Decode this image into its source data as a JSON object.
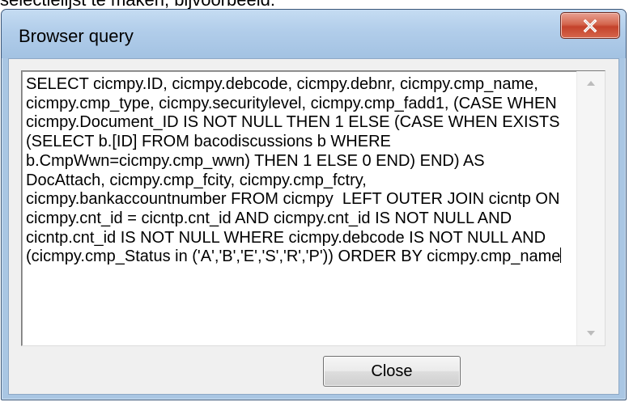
{
  "page": {
    "caption": "selectielijst te maken, bijvoorbeeld:"
  },
  "dialog": {
    "title": "Browser query",
    "close_x_glyph": "X",
    "query_text": "SELECT cicmpy.ID, cicmpy.debcode, cicmpy.debnr, cicmpy.cmp_name, cicmpy.cmp_type, cicmpy.securitylevel, cicmpy.cmp_fadd1, (CASE WHEN cicmpy.Document_ID IS NOT NULL THEN 1 ELSE (CASE WHEN EXISTS (SELECT b.[ID] FROM bacodiscussions b WHERE b.CmpWwn=cicmpy.cmp_wwn) THEN 1 ELSE 0 END) END) AS DocAttach, cicmpy.cmp_fcity, cicmpy.cmp_fctry, cicmpy.bankaccountnumber FROM cicmpy  LEFT OUTER JOIN cicntp ON cicmpy.cnt_id = cicntp.cnt_id AND cicmpy.cnt_id IS NOT NULL AND cicntp.cnt_id IS NOT NULL WHERE cicmpy.debcode IS NOT NULL AND (cicmpy.cmp_Status in ('A','B','E','S','R','P')) ORDER BY cicmpy.cmp_name",
    "close_button_label": "Close",
    "icons": {
      "scroll_up": "scroll-up-arrow-icon",
      "scroll_down": "scroll-down-arrow-icon",
      "close": "close-icon"
    }
  },
  "colors": {
    "frame": "#a9c6e3",
    "close_x": "#c4422b",
    "client": "#f0f0f0"
  }
}
